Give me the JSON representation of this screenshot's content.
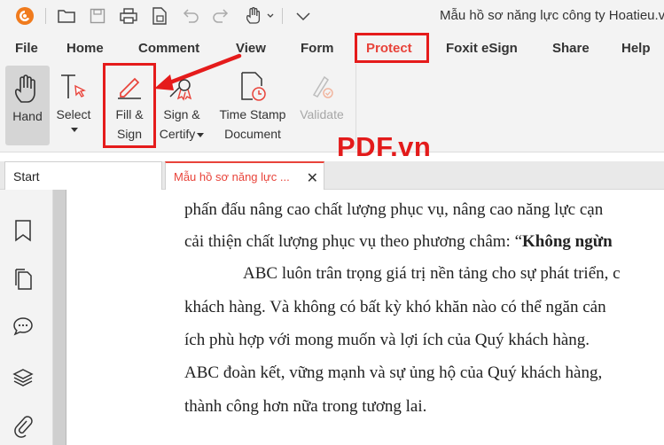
{
  "window": {
    "title": "Mẫu hồ sơ năng lực công ty Hoatieu.vn"
  },
  "menu": {
    "tabs": [
      {
        "label": "File"
      },
      {
        "label": "Home"
      },
      {
        "label": "Comment"
      },
      {
        "label": "View"
      },
      {
        "label": "Form"
      },
      {
        "label": "Protect",
        "active": true
      },
      {
        "label": "Foxit eSign"
      },
      {
        "label": "Share"
      },
      {
        "label": "Help"
      }
    ]
  },
  "ribbon": {
    "hand": "Hand",
    "select": "Select",
    "fill_line1": "Fill &",
    "fill_line2": "Sign",
    "sign_line1": "Sign &",
    "sign_line2": "Certify",
    "timestamp_line1": "Time Stamp",
    "timestamp_line2": "Document",
    "validate": "Validate"
  },
  "watermark": "PDF.vn",
  "doc_tabs": {
    "start": "Start",
    "active": "Mẫu hồ sơ năng lực ...",
    "close_symbol": "✕"
  },
  "document": {
    "line1": "phấn đấu nâng cao chất lượng phục vụ, nâng cao năng lực cạn",
    "line2_pre": "cải thiện chất lượng phục vụ theo phương châm: “",
    "line2_bold": "Không ngừn",
    "line3": "ABC luôn trân trọng giá trị nền tảng cho sự phát triển, c",
    "line4": "khách hàng. Và không có bất kỳ khó khăn nào có thể ngăn cản",
    "line5": "ích phù hợp với mong muốn và lợi ích của Quý khách hàng.",
    "line6": "ABC đoàn kết, vững mạnh và sự ủng hộ của Quý khách hàng,",
    "line7": "thành công hơn nữa trong tương lai."
  },
  "colors": {
    "accent": "#e8433a",
    "highlight_box": "#e51b1b",
    "toolbar_bg": "#f3f3f3"
  }
}
